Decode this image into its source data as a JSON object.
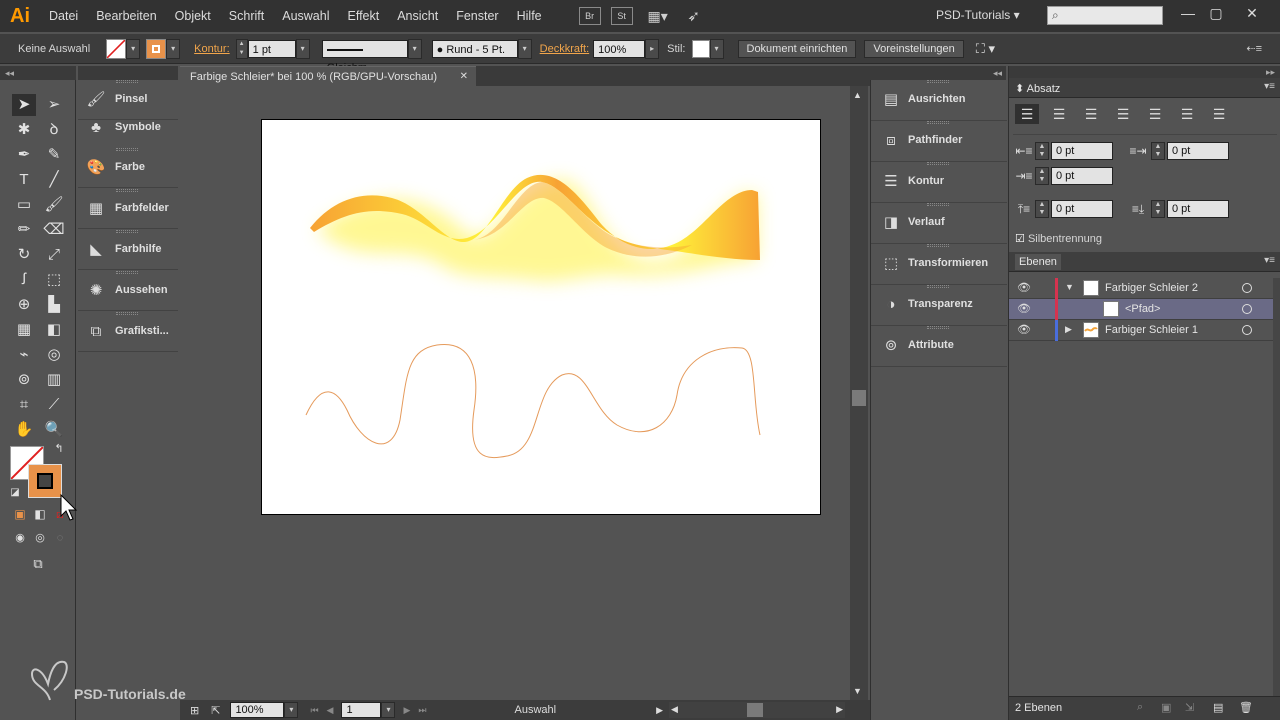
{
  "app": {
    "logo": "Ai",
    "menu": [
      "Datei",
      "Bearbeiten",
      "Objekt",
      "Schrift",
      "Auswahl",
      "Effekt",
      "Ansicht",
      "Fenster",
      "Hilfe"
    ],
    "bridge_label": "Br",
    "stock_label": "St",
    "workspace": "PSD-Tutorials",
    "search_icon": "search-icon",
    "window_controls": [
      "—",
      "▢",
      "✕"
    ]
  },
  "control_bar": {
    "selection": "Keine Auswahl",
    "stroke_label": "Kontur:",
    "stroke_weight": "1 pt",
    "stroke_profile": "Gleichm.",
    "brush": "Rund - 5 Pt.",
    "opacity_label": "Deckkraft:",
    "opacity_value": "100%",
    "style_label": "Stil:",
    "document_setup": "Dokument einrichten",
    "preferences": "Voreinstellungen",
    "stroke_color": "#e8924a"
  },
  "panels_left": [
    {
      "label": "Pinsel",
      "icon": "brush-icon"
    },
    {
      "label": "Symbole",
      "icon": "symbols-icon"
    },
    {
      "label": "Farbe",
      "icon": "palette-icon"
    },
    {
      "label": "Farbfelder",
      "icon": "swatches-icon"
    },
    {
      "label": "Farbhilfe",
      "icon": "color-guide-icon"
    },
    {
      "label": "Aussehen",
      "icon": "appearance-icon"
    },
    {
      "label": "Grafiksti...",
      "icon": "graphic-styles-icon"
    }
  ],
  "panels_right": [
    {
      "label": "Ausrichten",
      "icon": "align-icon"
    },
    {
      "label": "Pathfinder",
      "icon": "pathfinder-icon"
    },
    {
      "label": "Kontur",
      "icon": "stroke-icon"
    },
    {
      "label": "Verlauf",
      "icon": "gradient-icon"
    },
    {
      "label": "Transformieren",
      "icon": "transform-icon"
    },
    {
      "label": "Transparenz",
      "icon": "transparency-icon"
    },
    {
      "label": "Attribute",
      "icon": "attributes-icon"
    }
  ],
  "document": {
    "tab_title": "Farbige Schleier* bei 100 % (RGB/GPU-Vorschau)",
    "zoom": "100%",
    "artboard_number": "1",
    "status": "Auswahl",
    "ribbon_color_a": "#f7a234",
    "ribbon_color_b": "#fff23a",
    "path_color": "#e59a5b"
  },
  "paragraph": {
    "title": "Absatz",
    "left_indent": "0 pt",
    "right_indent": "0 pt",
    "first_line_indent": "0 pt",
    "space_before": "0 pt",
    "space_after": "0 pt",
    "hyphenation_label": "Silbentrennung",
    "hyphenation_checked": true
  },
  "layers": {
    "title": "Ebenen",
    "rows": [
      {
        "name": "Farbiger Schleier 2",
        "color": "#d6334f",
        "expanded": true
      },
      {
        "name": "<Pfad>",
        "color": "#d6334f",
        "selected": true
      },
      {
        "name": "Farbiger Schleier 1",
        "color": "#4a6edc",
        "expanded": false
      }
    ],
    "count": "2 Ebenen"
  },
  "watermark": {
    "text": "PSD-Tutorials.de"
  }
}
